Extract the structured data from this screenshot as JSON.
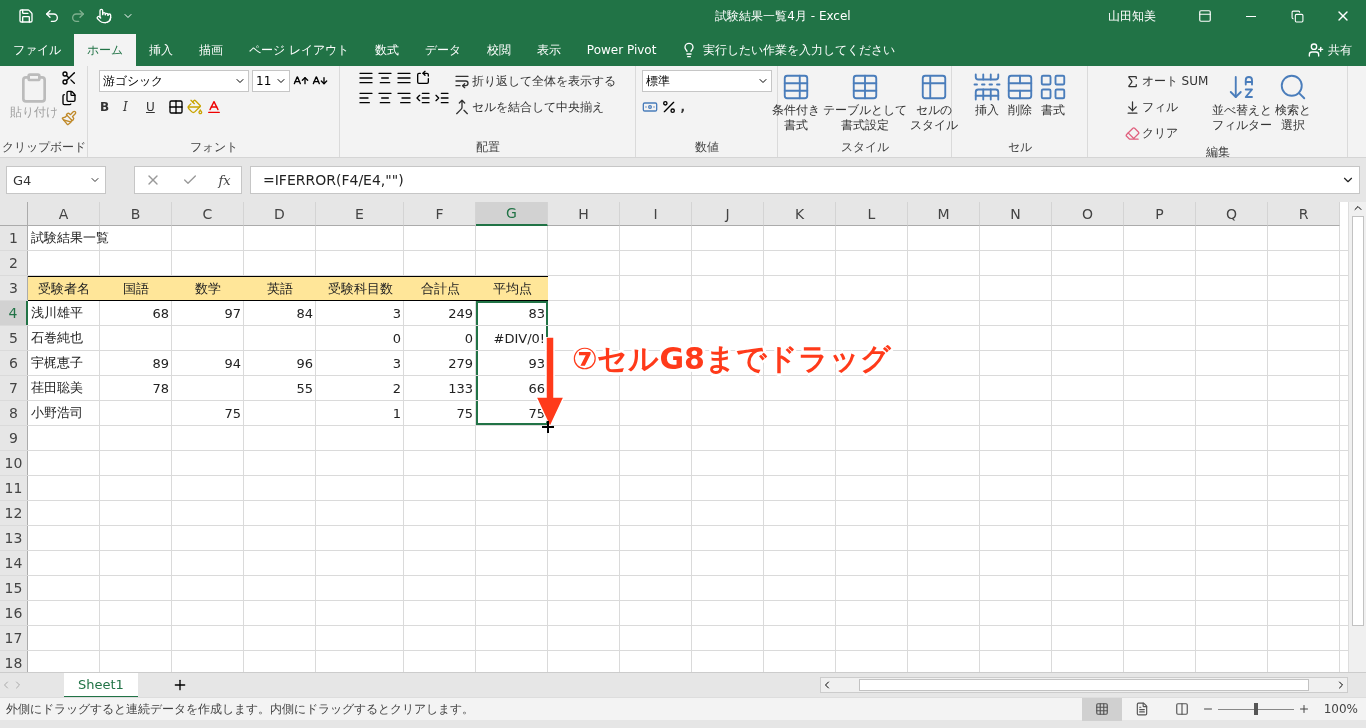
{
  "window": {
    "title": "試験結果一覧4月  -  Excel",
    "user": "山田知美"
  },
  "ribbon_tabs": [
    {
      "label": "ファイル",
      "selected": false
    },
    {
      "label": "ホーム",
      "selected": true
    },
    {
      "label": "挿入",
      "selected": false
    },
    {
      "label": "描画",
      "selected": false
    },
    {
      "label": "ページ レイアウト",
      "selected": false
    },
    {
      "label": "数式",
      "selected": false
    },
    {
      "label": "データ",
      "selected": false
    },
    {
      "label": "校閲",
      "selected": false
    },
    {
      "label": "表示",
      "selected": false
    },
    {
      "label": "Power Pivot",
      "selected": false
    }
  ],
  "tell_me": {
    "placeholder": "実行したい作業を入力してください"
  },
  "share": "共有",
  "ribbon_groups": [
    {
      "kind": "clipboard",
      "label": "クリップボード",
      "paste": {
        "label": "貼り付け",
        "disabled": true
      }
    },
    {
      "kind": "font",
      "label": "フォント",
      "font_name": "游ゴシック",
      "font_size": "11",
      "styles": [
        "B",
        "I",
        "U"
      ]
    },
    {
      "kind": "alignment",
      "label": "配置",
      "wrap": "折り返して全体を表示する",
      "merge": "セルを結合して中央揃え"
    },
    {
      "kind": "number",
      "label": "数値",
      "format": "標準",
      "comma": ","
    },
    {
      "kind": "large",
      "label": "スタイル",
      "buttons": [
        {
          "lines": [
            "条件付き",
            "書式"
          ]
        },
        {
          "lines": [
            "テーブルとして",
            "書式設定"
          ]
        },
        {
          "lines": [
            "セルの",
            "スタイル"
          ]
        }
      ]
    },
    {
      "kind": "large",
      "label": "セル",
      "buttons": [
        {
          "lines": [
            "挿入"
          ]
        },
        {
          "lines": [
            "削除"
          ]
        },
        {
          "lines": [
            "書式"
          ]
        }
      ]
    },
    {
      "kind": "editing",
      "label": "編集",
      "small": [
        "オート SUM",
        "フィル",
        "クリア"
      ],
      "buttons": [
        {
          "lines": [
            "並べ替えと",
            "フィルター"
          ]
        },
        {
          "lines": [
            "検索と",
            "選択"
          ]
        }
      ]
    }
  ],
  "formula_bar": {
    "name_box": "G4",
    "fx_label": "fx",
    "formula": "=IFERROR(F4/E4,\"\")"
  },
  "sheet": {
    "columns": [
      {
        "label": "A",
        "selected": false
      },
      {
        "label": "B",
        "selected": false
      },
      {
        "label": "C",
        "selected": false
      },
      {
        "label": "D",
        "selected": false
      },
      {
        "label": "E",
        "selected": false
      },
      {
        "label": "F",
        "selected": false
      },
      {
        "label": "G",
        "selected": true
      },
      {
        "label": "H",
        "selected": false
      },
      {
        "label": "I",
        "selected": false
      },
      {
        "label": "J",
        "selected": false
      },
      {
        "label": "K",
        "selected": false
      },
      {
        "label": "L",
        "selected": false
      },
      {
        "label": "M",
        "selected": false
      },
      {
        "label": "N",
        "selected": false
      },
      {
        "label": "O",
        "selected": false
      },
      {
        "label": "P",
        "selected": false
      },
      {
        "label": "Q",
        "selected": false
      },
      {
        "label": "R",
        "selected": false
      }
    ],
    "rows": [
      {
        "header": "1",
        "kind": "title",
        "selected": false,
        "in_range": false,
        "cells": [
          "試験結果一覧"
        ]
      },
      {
        "header": "2",
        "kind": "data",
        "selected": false,
        "in_range": false
      },
      {
        "header": "3",
        "kind": "header",
        "selected": false,
        "in_range": false,
        "cells": [
          "受験者名",
          "国語",
          "数学",
          "英語",
          "受験科目数",
          "合計点",
          "平均点"
        ]
      },
      {
        "header": "4",
        "kind": "data",
        "selected": true,
        "in_range": true,
        "cells": [
          "浅川雄平",
          "68",
          "97",
          "84",
          "3",
          "249",
          "83"
        ]
      },
      {
        "header": "5",
        "kind": "data",
        "selected": false,
        "in_range": true,
        "cells": [
          "石巻純也",
          null,
          null,
          null,
          "0",
          "0",
          "#DIV/0!"
        ]
      },
      {
        "header": "6",
        "kind": "data",
        "selected": false,
        "in_range": true,
        "cells": [
          "宇梶恵子",
          "89",
          "94",
          "96",
          "3",
          "279",
          "93"
        ]
      },
      {
        "header": "7",
        "kind": "data",
        "selected": false,
        "in_range": true,
        "cells": [
          "荏田聡美",
          "78",
          null,
          "55",
          "2",
          "133",
          "66"
        ]
      },
      {
        "header": "8",
        "kind": "data",
        "selected": false,
        "in_range": true,
        "cells": [
          "小野浩司",
          null,
          "75",
          null,
          "1",
          "75",
          "75"
        ]
      },
      {
        "header": "9",
        "kind": "data",
        "selected": false,
        "in_range": false
      },
      {
        "header": "10",
        "kind": "data",
        "selected": false,
        "in_range": false
      },
      {
        "header": "11",
        "kind": "data",
        "selected": false,
        "in_range": false
      },
      {
        "header": "12",
        "kind": "data",
        "selected": false,
        "in_range": false
      },
      {
        "header": "13",
        "kind": "data",
        "selected": false,
        "in_range": false
      },
      {
        "header": "14",
        "kind": "data",
        "selected": false,
        "in_range": false
      },
      {
        "header": "15",
        "kind": "data",
        "selected": false,
        "in_range": false
      },
      {
        "header": "16",
        "kind": "data",
        "selected": false,
        "in_range": false
      },
      {
        "header": "17",
        "kind": "data",
        "selected": false,
        "in_range": false
      },
      {
        "header": "18",
        "kind": "data",
        "selected": false,
        "in_range": false
      }
    ]
  },
  "annotation": "⑦セルG8までドラッグ",
  "sheet_tabs": [
    {
      "label": "Sheet1",
      "selected": true
    }
  ],
  "status_bar": {
    "message": "外側にドラッグすると連続データを作成します。内側にドラッグするとクリアします。",
    "zoom": {
      "level": 0.5,
      "reading": "100%"
    }
  }
}
